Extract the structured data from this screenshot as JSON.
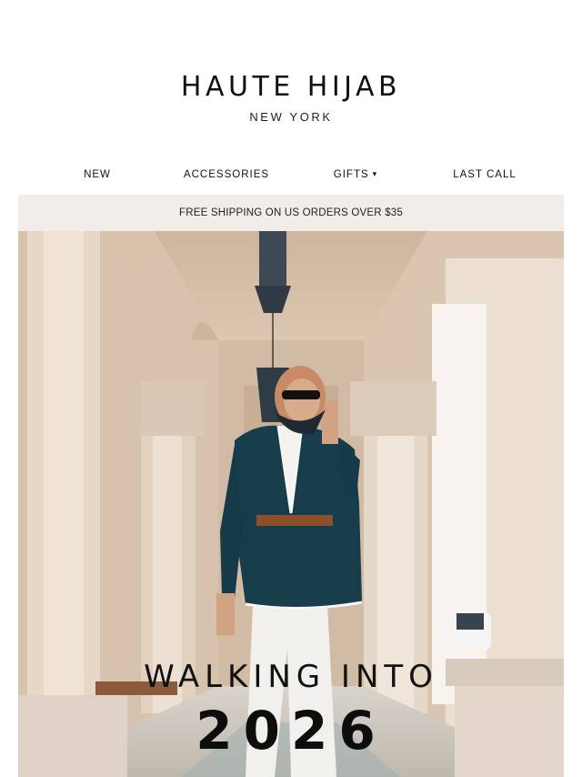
{
  "brand": {
    "name": "HAUTE HIJAB",
    "location": "NEW YORK"
  },
  "nav": {
    "items": [
      {
        "label": "NEW"
      },
      {
        "label": "ACCESSORIES"
      },
      {
        "label": "GIFTS",
        "icon": "chevron-down-icon"
      },
      {
        "label": "LAST CALL"
      }
    ]
  },
  "banner": {
    "text": "FREE SHIPPING ON US ORDERS OVER $35"
  },
  "hero": {
    "headline": "WALKING INTO",
    "year": "2026"
  },
  "colors": {
    "banner_bg": "#f2ede8",
    "text": "#111111",
    "hero_wall": "#d9c8b6"
  }
}
